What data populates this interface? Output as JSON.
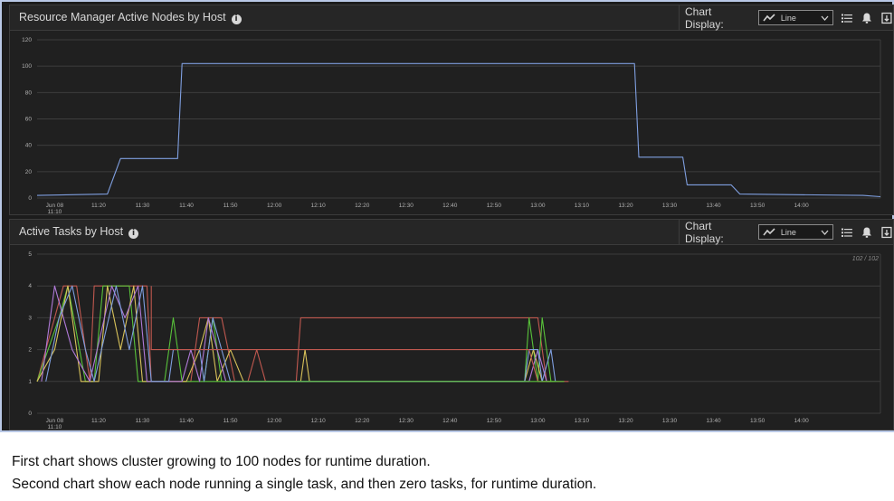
{
  "panels": [
    {
      "title": "Resource Manager Active Nodes by Host",
      "chart_display_label": "Chart Display:",
      "select_value": "Line",
      "icons": [
        "line-chart-icon",
        "chevron-down-icon",
        "list-icon",
        "alert-bell-icon",
        "export-icon"
      ]
    },
    {
      "title": "Active Tasks by Host",
      "chart_display_label": "Chart Display:",
      "select_value": "Line",
      "counter": "102 / 102",
      "icons": [
        "line-chart-icon",
        "chevron-down-icon",
        "list-icon",
        "alert-bell-icon",
        "export-icon"
      ]
    }
  ],
  "captions": [
    "First chart shows cluster growing to 100 nodes for runtime duration.",
    "Second chart show each node running a single task, and then zero tasks, for runtime duration."
  ],
  "colors": {
    "background": "#202020",
    "grid": "#3d3d3d",
    "axis_text": "#b0b0b0",
    "line_blue": "#7f9fe0",
    "series_red": "#c0584f",
    "series_green": "#58c23a",
    "series_yellow": "#d8c25a",
    "series_purple": "#b07ad8",
    "frame_border": "#b9c8e6"
  },
  "chart_data": [
    {
      "type": "line",
      "title": "Resource Manager Active Nodes by Host",
      "xlabel": "",
      "ylabel": "",
      "x_ticks": [
        "Jun 08\n11:10",
        "11:20",
        "11:30",
        "11:40",
        "11:50",
        "12:00",
        "12:10",
        "12:20",
        "12:30",
        "12:40",
        "12:50",
        "13:00",
        "13:10",
        "13:20",
        "13:30",
        "13:40",
        "13:50",
        "14:00"
      ],
      "y_ticks": [
        0,
        20,
        40,
        60,
        80,
        100,
        120
      ],
      "ylim": [
        0,
        120
      ],
      "xlim_minutes": [
        -4,
        188
      ],
      "grid": true,
      "series": [
        {
          "color": "line_blue",
          "points": [
            [
              -4,
              2
            ],
            [
              12,
              3
            ],
            [
              15,
              30
            ],
            [
              28,
              30
            ],
            [
              29,
              102
            ],
            [
              132,
              102
            ],
            [
              133,
              31
            ],
            [
              143,
              31
            ],
            [
              144,
              10
            ],
            [
              154,
              10
            ],
            [
              156,
              3
            ],
            [
              184,
              2
            ],
            [
              188,
              1
            ]
          ]
        }
      ]
    },
    {
      "type": "line",
      "title": "Active Tasks by Host",
      "xlabel": "",
      "ylabel": "",
      "x_ticks": [
        "Jun 08\n11:10",
        "11:20",
        "11:30",
        "11:40",
        "11:50",
        "12:00",
        "12:10",
        "12:20",
        "12:30",
        "12:40",
        "12:50",
        "13:00",
        "13:10",
        "13:20",
        "13:30",
        "13:40",
        "13:50",
        "14:00"
      ],
      "y_ticks": [
        0,
        1,
        2,
        3,
        4,
        5
      ],
      "ylim": [
        0,
        5
      ],
      "xlim_minutes": [
        -4,
        188
      ],
      "grid": true,
      "series": [
        {
          "color": "series_red",
          "points": [
            [
              -4,
              1
            ],
            [
              0,
              3
            ],
            [
              2,
              4
            ],
            [
              5,
              4
            ],
            [
              8,
              1
            ],
            [
              9,
              4
            ],
            [
              21,
              4
            ],
            [
              22,
              1
            ],
            [
              31,
              1
            ],
            [
              33,
              3
            ],
            [
              38,
              3
            ],
            [
              41,
              1
            ],
            [
              44,
              1
            ],
            [
              46,
              2
            ],
            [
              48,
              1
            ],
            [
              55,
              1
            ],
            [
              56,
              3
            ],
            [
              110,
              3
            ],
            [
              112,
              1
            ],
            [
              117,
              1
            ]
          ]
        },
        {
          "color": "series_green",
          "points": [
            [
              -4,
              1
            ],
            [
              1,
              3
            ],
            [
              3,
              4
            ],
            [
              7,
              1
            ],
            [
              9,
              1
            ],
            [
              11,
              4
            ],
            [
              17,
              4
            ],
            [
              19,
              1
            ],
            [
              25,
              1
            ],
            [
              27,
              3
            ],
            [
              29,
              1
            ],
            [
              34,
              1
            ],
            [
              36,
              3
            ],
            [
              38,
              1
            ],
            [
              60,
              1
            ],
            [
              107,
              1
            ],
            [
              108,
              3
            ],
            [
              110,
              1
            ],
            [
              111,
              3
            ],
            [
              113,
              1
            ],
            [
              114,
              1
            ]
          ]
        },
        {
          "color": "series_yellow",
          "points": [
            [
              -4,
              1
            ],
            [
              0,
              2
            ],
            [
              3,
              4
            ],
            [
              6,
              1
            ],
            [
              10,
              1
            ],
            [
              12,
              4
            ],
            [
              15,
              2
            ],
            [
              18,
              4
            ],
            [
              20,
              1
            ],
            [
              30,
              1
            ],
            [
              33,
              2
            ],
            [
              35,
              3
            ],
            [
              37,
              1
            ],
            [
              40,
              2
            ],
            [
              43,
              1
            ],
            [
              56,
              1
            ],
            [
              57,
              2
            ],
            [
              58,
              1
            ],
            [
              107,
              1
            ],
            [
              109,
              2
            ],
            [
              111,
              1
            ],
            [
              113,
              1
            ]
          ]
        },
        {
          "color": "series_purple",
          "points": [
            [
              -3,
              1
            ],
            [
              0,
              4
            ],
            [
              4,
              2
            ],
            [
              8,
              1
            ],
            [
              13,
              4
            ],
            [
              16,
              3
            ],
            [
              19,
              4
            ],
            [
              21,
              1
            ],
            [
              29,
              1
            ],
            [
              31,
              2
            ],
            [
              33,
              1
            ],
            [
              35,
              3
            ],
            [
              37,
              2
            ],
            [
              39,
              1
            ],
            [
              108,
              1
            ],
            [
              110,
              2
            ],
            [
              112,
              1
            ]
          ]
        },
        {
          "color": "line_blue",
          "points": [
            [
              -2,
              1
            ],
            [
              1,
              3
            ],
            [
              4,
              4
            ],
            [
              7,
              2
            ],
            [
              9,
              1
            ],
            [
              14,
              4
            ],
            [
              17,
              2
            ],
            [
              20,
              4
            ],
            [
              22,
              1
            ],
            [
              26,
              1
            ],
            [
              27,
              2
            ],
            [
              33,
              2
            ],
            [
              34,
              1
            ],
            [
              36,
              3
            ],
            [
              38,
              2
            ],
            [
              40,
              1
            ],
            [
              107,
              1
            ],
            [
              108,
              2
            ],
            [
              110,
              2
            ],
            [
              111,
              1
            ],
            [
              113,
              2
            ],
            [
              114,
              1
            ]
          ]
        },
        {
          "color": "series_red",
          "points": [
            [
              22,
              4
            ],
            [
              22,
              2
            ],
            [
              108,
              2
            ],
            [
              110,
              1
            ],
            [
              112,
              1
            ]
          ]
        },
        {
          "color": "series_green",
          "points": [
            [
              34,
              1
            ],
            [
              116,
              1
            ]
          ]
        }
      ]
    }
  ]
}
